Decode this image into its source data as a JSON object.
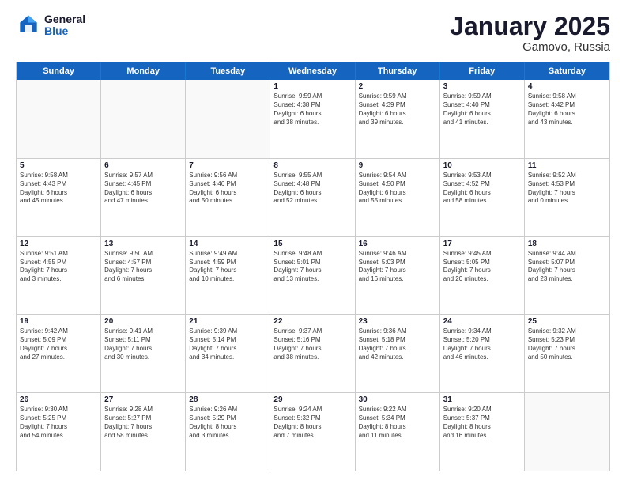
{
  "logo": {
    "line1": "General",
    "line2": "Blue"
  },
  "title": "January 2025",
  "location": "Gamovo, Russia",
  "days": [
    "Sunday",
    "Monday",
    "Tuesday",
    "Wednesday",
    "Thursday",
    "Friday",
    "Saturday"
  ],
  "weeks": [
    [
      {
        "day": "",
        "text": ""
      },
      {
        "day": "",
        "text": ""
      },
      {
        "day": "",
        "text": ""
      },
      {
        "day": "1",
        "text": "Sunrise: 9:59 AM\nSunset: 4:38 PM\nDaylight: 6 hours\nand 38 minutes."
      },
      {
        "day": "2",
        "text": "Sunrise: 9:59 AM\nSunset: 4:39 PM\nDaylight: 6 hours\nand 39 minutes."
      },
      {
        "day": "3",
        "text": "Sunrise: 9:59 AM\nSunset: 4:40 PM\nDaylight: 6 hours\nand 41 minutes."
      },
      {
        "day": "4",
        "text": "Sunrise: 9:58 AM\nSunset: 4:42 PM\nDaylight: 6 hours\nand 43 minutes."
      }
    ],
    [
      {
        "day": "5",
        "text": "Sunrise: 9:58 AM\nSunset: 4:43 PM\nDaylight: 6 hours\nand 45 minutes."
      },
      {
        "day": "6",
        "text": "Sunrise: 9:57 AM\nSunset: 4:45 PM\nDaylight: 6 hours\nand 47 minutes."
      },
      {
        "day": "7",
        "text": "Sunrise: 9:56 AM\nSunset: 4:46 PM\nDaylight: 6 hours\nand 50 minutes."
      },
      {
        "day": "8",
        "text": "Sunrise: 9:55 AM\nSunset: 4:48 PM\nDaylight: 6 hours\nand 52 minutes."
      },
      {
        "day": "9",
        "text": "Sunrise: 9:54 AM\nSunset: 4:50 PM\nDaylight: 6 hours\nand 55 minutes."
      },
      {
        "day": "10",
        "text": "Sunrise: 9:53 AM\nSunset: 4:52 PM\nDaylight: 6 hours\nand 58 minutes."
      },
      {
        "day": "11",
        "text": "Sunrise: 9:52 AM\nSunset: 4:53 PM\nDaylight: 7 hours\nand 0 minutes."
      }
    ],
    [
      {
        "day": "12",
        "text": "Sunrise: 9:51 AM\nSunset: 4:55 PM\nDaylight: 7 hours\nand 3 minutes."
      },
      {
        "day": "13",
        "text": "Sunrise: 9:50 AM\nSunset: 4:57 PM\nDaylight: 7 hours\nand 6 minutes."
      },
      {
        "day": "14",
        "text": "Sunrise: 9:49 AM\nSunset: 4:59 PM\nDaylight: 7 hours\nand 10 minutes."
      },
      {
        "day": "15",
        "text": "Sunrise: 9:48 AM\nSunset: 5:01 PM\nDaylight: 7 hours\nand 13 minutes."
      },
      {
        "day": "16",
        "text": "Sunrise: 9:46 AM\nSunset: 5:03 PM\nDaylight: 7 hours\nand 16 minutes."
      },
      {
        "day": "17",
        "text": "Sunrise: 9:45 AM\nSunset: 5:05 PM\nDaylight: 7 hours\nand 20 minutes."
      },
      {
        "day": "18",
        "text": "Sunrise: 9:44 AM\nSunset: 5:07 PM\nDaylight: 7 hours\nand 23 minutes."
      }
    ],
    [
      {
        "day": "19",
        "text": "Sunrise: 9:42 AM\nSunset: 5:09 PM\nDaylight: 7 hours\nand 27 minutes."
      },
      {
        "day": "20",
        "text": "Sunrise: 9:41 AM\nSunset: 5:11 PM\nDaylight: 7 hours\nand 30 minutes."
      },
      {
        "day": "21",
        "text": "Sunrise: 9:39 AM\nSunset: 5:14 PM\nDaylight: 7 hours\nand 34 minutes."
      },
      {
        "day": "22",
        "text": "Sunrise: 9:37 AM\nSunset: 5:16 PM\nDaylight: 7 hours\nand 38 minutes."
      },
      {
        "day": "23",
        "text": "Sunrise: 9:36 AM\nSunset: 5:18 PM\nDaylight: 7 hours\nand 42 minutes."
      },
      {
        "day": "24",
        "text": "Sunrise: 9:34 AM\nSunset: 5:20 PM\nDaylight: 7 hours\nand 46 minutes."
      },
      {
        "day": "25",
        "text": "Sunrise: 9:32 AM\nSunset: 5:23 PM\nDaylight: 7 hours\nand 50 minutes."
      }
    ],
    [
      {
        "day": "26",
        "text": "Sunrise: 9:30 AM\nSunset: 5:25 PM\nDaylight: 7 hours\nand 54 minutes."
      },
      {
        "day": "27",
        "text": "Sunrise: 9:28 AM\nSunset: 5:27 PM\nDaylight: 7 hours\nand 58 minutes."
      },
      {
        "day": "28",
        "text": "Sunrise: 9:26 AM\nSunset: 5:29 PM\nDaylight: 8 hours\nand 3 minutes."
      },
      {
        "day": "29",
        "text": "Sunrise: 9:24 AM\nSunset: 5:32 PM\nDaylight: 8 hours\nand 7 minutes."
      },
      {
        "day": "30",
        "text": "Sunrise: 9:22 AM\nSunset: 5:34 PM\nDaylight: 8 hours\nand 11 minutes."
      },
      {
        "day": "31",
        "text": "Sunrise: 9:20 AM\nSunset: 5:37 PM\nDaylight: 8 hours\nand 16 minutes."
      },
      {
        "day": "",
        "text": ""
      }
    ]
  ]
}
